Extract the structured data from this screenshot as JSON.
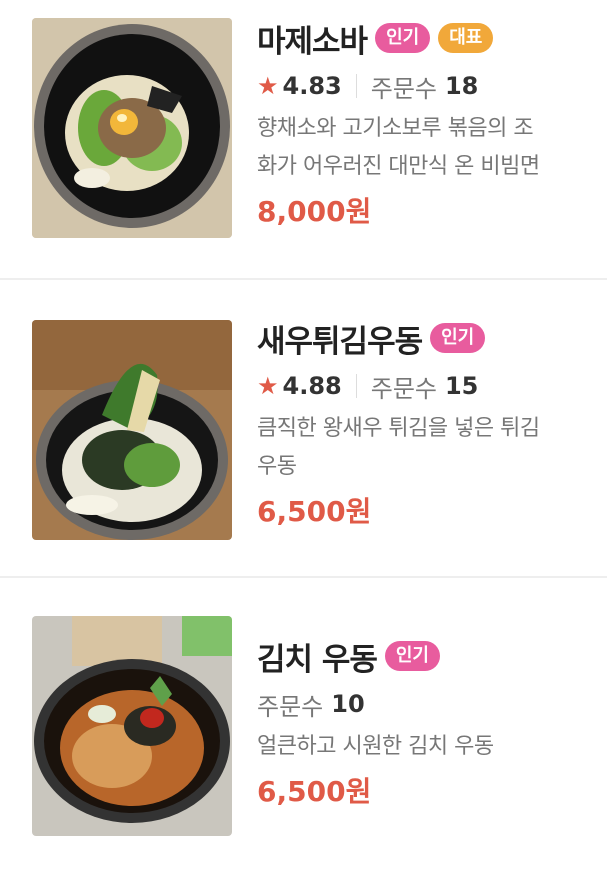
{
  "menu_items": [
    {
      "name": "마제소바",
      "badges": [
        "인기",
        "대표"
      ],
      "rating": "4.83",
      "orders_label": "주문수",
      "orders": "18",
      "desc_lines": [
        "향채소와 고기소보루 볶음의 조",
        "화가 어우러진 대만식 온 비빔면"
      ],
      "price": "8,000원"
    },
    {
      "name": "새우튀김우동",
      "badges": [
        "인기"
      ],
      "rating": "4.88",
      "orders_label": "주문수",
      "orders": "15",
      "desc_lines": [
        "큼직한 왕새우 튀김을 넣은 튀김",
        "우동"
      ],
      "price": "6,500원"
    },
    {
      "name": "김치 우동",
      "badges": [
        "인기"
      ],
      "orders_label": "주문수",
      "orders": "10",
      "desc_lines": [
        "얼큰하고 시원한 김치 우동"
      ],
      "price": "6,500원"
    }
  ],
  "icons": {
    "rating": "star-icon"
  },
  "colors": {
    "accent_red": "#e05a47",
    "badge_pink": "#e85c9e",
    "badge_orange": "#f1a83a"
  }
}
